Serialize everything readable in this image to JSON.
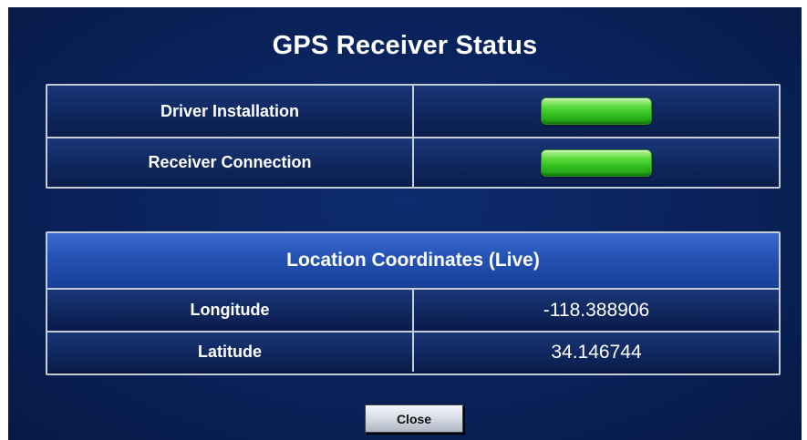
{
  "dialog": {
    "title": "GPS Receiver Status"
  },
  "status": {
    "rows": [
      {
        "label": "Driver Installation",
        "indicator": "green-ok"
      },
      {
        "label": "Receiver Connection",
        "indicator": "green-ok"
      }
    ],
    "indicator_color": "#3cc828"
  },
  "location": {
    "header": "Location Coordinates (Live)",
    "rows": [
      {
        "label": "Longitude",
        "value": "-118.388906"
      },
      {
        "label": "Latitude",
        "value": "34.146744"
      }
    ]
  },
  "buttons": {
    "close_label": "Close"
  },
  "colors": {
    "background": "#0a225a",
    "header_blue": "#2552b3",
    "border": "#c4ccd8"
  }
}
